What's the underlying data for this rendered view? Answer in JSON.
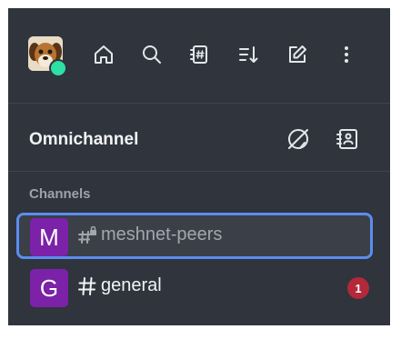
{
  "user": {
    "avatar_icon": "dog-avatar-icon",
    "status": "online",
    "status_color": "#2de0a5"
  },
  "toolbar": {
    "icons": [
      "home-icon",
      "search-icon",
      "directory-icon",
      "sort-icon",
      "create-new-icon",
      "kebab-menu-icon"
    ]
  },
  "omnichannel": {
    "title": "Omnichannel",
    "icons": [
      "omnichannel-status-icon",
      "contact-center-icon"
    ]
  },
  "channels": {
    "section_label": "Channels",
    "items": [
      {
        "avatar_letter": "M",
        "type_icon": "hashtag-lock-icon",
        "name": "meshnet-peers",
        "selected": true,
        "unread": ""
      },
      {
        "avatar_letter": "G",
        "type_icon": "hashtag-icon",
        "name": "general",
        "selected": false,
        "unread": "1"
      }
    ]
  },
  "colors": {
    "sidebar_bg": "#2f343d",
    "accent": "#5b8def",
    "room_avatar": "#7b22a8",
    "badge": "#b3293a"
  }
}
